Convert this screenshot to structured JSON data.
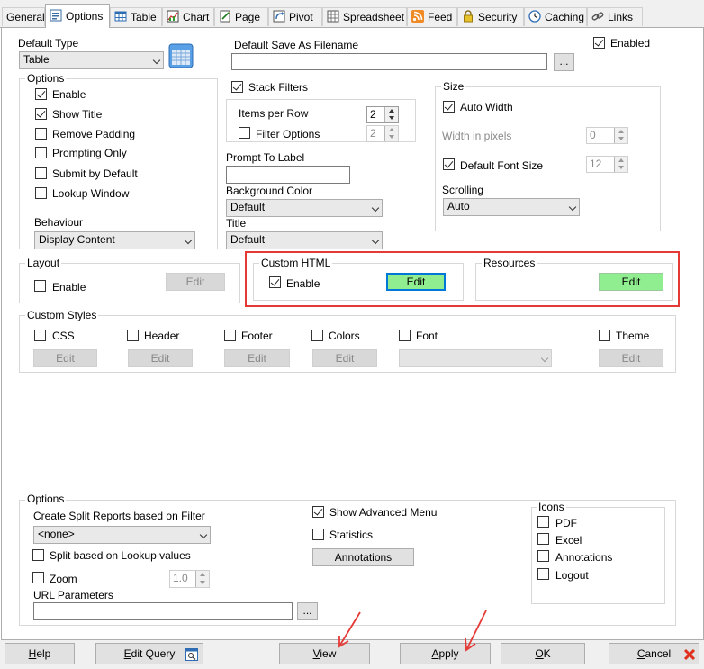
{
  "tabs": [
    {
      "label": "General",
      "icon": "none"
    },
    {
      "label": "Options",
      "icon": "options-icon",
      "active": true
    },
    {
      "label": "Table",
      "icon": "table-icon"
    },
    {
      "label": "Chart",
      "icon": "chart-icon"
    },
    {
      "label": "Page",
      "icon": "page-icon"
    },
    {
      "label": "Pivot",
      "icon": "pivot-icon"
    },
    {
      "label": "Spreadsheet",
      "icon": "spreadsheet-icon"
    },
    {
      "label": "Feed",
      "icon": "rss-feed-icon"
    },
    {
      "label": "Security",
      "icon": "lock-icon"
    },
    {
      "label": "Caching",
      "icon": "clock-icon"
    },
    {
      "label": "Links",
      "icon": "link-icon"
    }
  ],
  "top": {
    "default_type_label": "Default Type",
    "default_type_value": "Table",
    "save_as_label": "Default Save As Filename",
    "save_as_value": "",
    "browse_label": "...",
    "enabled_label": "Enabled",
    "enabled_checked": true
  },
  "options": {
    "title": "Options",
    "enable": "Enable",
    "show_title": "Show Title",
    "remove_padding": "Remove Padding",
    "prompting_only": "Prompting Only",
    "submit_by_default": "Submit by Default",
    "lookup_window": "Lookup Window",
    "behaviour_label": "Behaviour",
    "behaviour_value": "Display Content"
  },
  "filters": {
    "stack_filters": "Stack Filters",
    "items_per_row_label": "Items per Row",
    "items_per_row_value": "2",
    "filter_options": "Filter Options",
    "filter_options_value": "2",
    "prompt_to_label": "Prompt To Label",
    "prompt_to_value": "",
    "background_color_label": "Background Color",
    "background_color_value": "Default",
    "title_label": "Title",
    "title_value": "Default"
  },
  "size": {
    "title": "Size",
    "auto_width": "Auto Width",
    "width_in_pixels": "Width in pixels",
    "width_value": "0",
    "default_font_size": "Default Font Size",
    "font_size_value": "12",
    "scrolling_label": "Scrolling",
    "scrolling_value": "Auto"
  },
  "layout": {
    "title": "Layout",
    "enable": "Enable",
    "edit": "Edit"
  },
  "custom_html": {
    "title": "Custom HTML",
    "enable": "Enable",
    "edit": "Edit"
  },
  "resources": {
    "title": "Resources",
    "edit": "Edit"
  },
  "custom_styles": {
    "title": "Custom Styles",
    "css": "CSS",
    "header": "Header",
    "footer": "Footer",
    "colors": "Colors",
    "font": "Font",
    "theme": "Theme",
    "edit": "Edit",
    "font_value": ""
  },
  "lower_options": {
    "title": "Options",
    "split_reports_label": "Create Split Reports based on Filter",
    "split_reports_value": "<none>",
    "split_lookup": "Split based on Lookup values",
    "zoom": "Zoom",
    "zoom_value": "1.0",
    "url_params_label": "URL Parameters",
    "url_params_value": "",
    "browse_label": "...",
    "show_advanced_menu": "Show Advanced Menu",
    "statistics": "Statistics",
    "annotations_button": "Annotations"
  },
  "icons_group": {
    "title": "Icons",
    "pdf": "PDF",
    "excel": "Excel",
    "annotations": "Annotations",
    "logout": "Logout"
  },
  "footer": {
    "help_mn": "H",
    "help_rest": "elp",
    "edit_query_mn": "E",
    "edit_query_rest": "dit Query",
    "view_mn": "V",
    "view_rest": "iew",
    "apply_mn": "A",
    "apply_rest": "pply",
    "ok_mn": "O",
    "ok_rest": "K",
    "cancel_mn": "C",
    "cancel_rest": "ancel"
  },
  "colors": {
    "accent_red": "#e53935",
    "edit_green": "#90ee90",
    "focus_blue": "#0078d7"
  }
}
